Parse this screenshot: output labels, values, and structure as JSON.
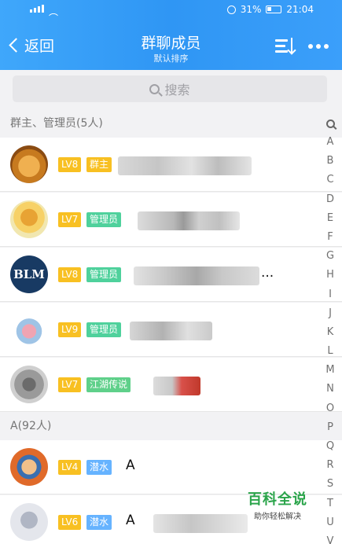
{
  "status_bar": {
    "battery": "31%",
    "time": "21:04"
  },
  "nav": {
    "back_label": "返回",
    "title": "群聊成员",
    "subtitle": "默认排序"
  },
  "search": {
    "placeholder": "搜索"
  },
  "sections": [
    {
      "label": "群主、管理员(5人)"
    },
    {
      "label": "A(92人)"
    }
  ],
  "members": [
    {
      "level": "LV8",
      "role": "群主",
      "role_type": "owner",
      "name": ""
    },
    {
      "level": "LV7",
      "role": "管理员",
      "role_type": "admin",
      "name": ""
    },
    {
      "level": "LV8",
      "role": "管理员",
      "role_type": "admin",
      "name": "..."
    },
    {
      "level": "LV9",
      "role": "管理员",
      "role_type": "admin",
      "name": ""
    },
    {
      "level": "LV7",
      "role": "江湖传说",
      "role_type": "title",
      "name": ""
    },
    {
      "level": "LV4",
      "role": "潜水",
      "role_type": "lurk",
      "name": "A"
    },
    {
      "level": "LV6",
      "role": "潜水",
      "role_type": "lurk",
      "name": "A"
    }
  ],
  "index_letters": [
    "A",
    "B",
    "C",
    "D",
    "E",
    "F",
    "G",
    "H",
    "I",
    "J",
    "K",
    "L",
    "M",
    "N",
    "O",
    "P",
    "Q",
    "R",
    "S",
    "T",
    "U",
    "V"
  ],
  "colors": {
    "header": "#3a9ff8",
    "level_badge": "#f8c022",
    "admin_badge": "#4fd19c",
    "lurk_badge": "#66b3ff"
  },
  "watermark": {
    "title": "百科全说",
    "tagline": "助你轻松解决"
  }
}
